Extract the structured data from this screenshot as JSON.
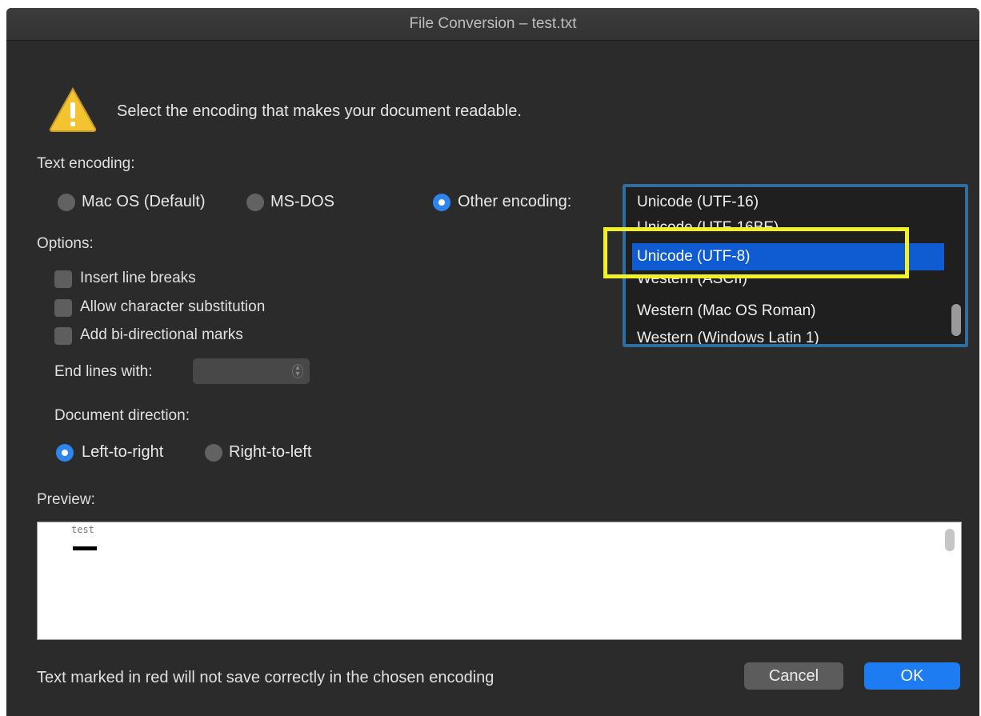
{
  "window": {
    "title": "File Conversion – test.txt"
  },
  "message": "Select the encoding that makes your document readable.",
  "text_encoding": {
    "label": "Text encoding:",
    "options": [
      {
        "label": "Mac OS (Default)",
        "selected": false
      },
      {
        "label": "MS-DOS",
        "selected": false
      },
      {
        "label": "Other encoding:",
        "selected": true
      }
    ],
    "list": [
      {
        "label": "Unicode (UTF-16)",
        "selected": false
      },
      {
        "label": "Unicode (UTF-16BE)",
        "selected": false
      },
      {
        "label": "Unicode (UTF-8)",
        "selected": true
      },
      {
        "label": "Western (ASCII)",
        "selected": false
      },
      {
        "label": "Western (Mac OS Roman)",
        "selected": false
      },
      {
        "label": "Western (Windows Latin 1)",
        "selected": false
      }
    ]
  },
  "options": {
    "label": "Options:",
    "checkboxes": [
      {
        "label": "Insert line breaks",
        "checked": false
      },
      {
        "label": "Allow character substitution",
        "checked": false
      },
      {
        "label": "Add bi-directional marks",
        "checked": false
      }
    ],
    "end_lines_label": "End lines with:",
    "end_lines_value": "",
    "direction_label": "Document direction:",
    "directions": [
      {
        "label": "Left-to-right",
        "selected": true
      },
      {
        "label": "Right-to-left",
        "selected": false
      }
    ]
  },
  "preview": {
    "label": "Preview:",
    "text": "test"
  },
  "footer": {
    "note": "Text marked in red will not save correctly in the chosen encoding",
    "cancel_label": "Cancel",
    "ok_label": "OK"
  },
  "colors": {
    "accent": "#1e7cf2",
    "selection": "#0f5bd1",
    "highlight": "#f2ef2b",
    "focus_ring": "#2f6e9e"
  }
}
